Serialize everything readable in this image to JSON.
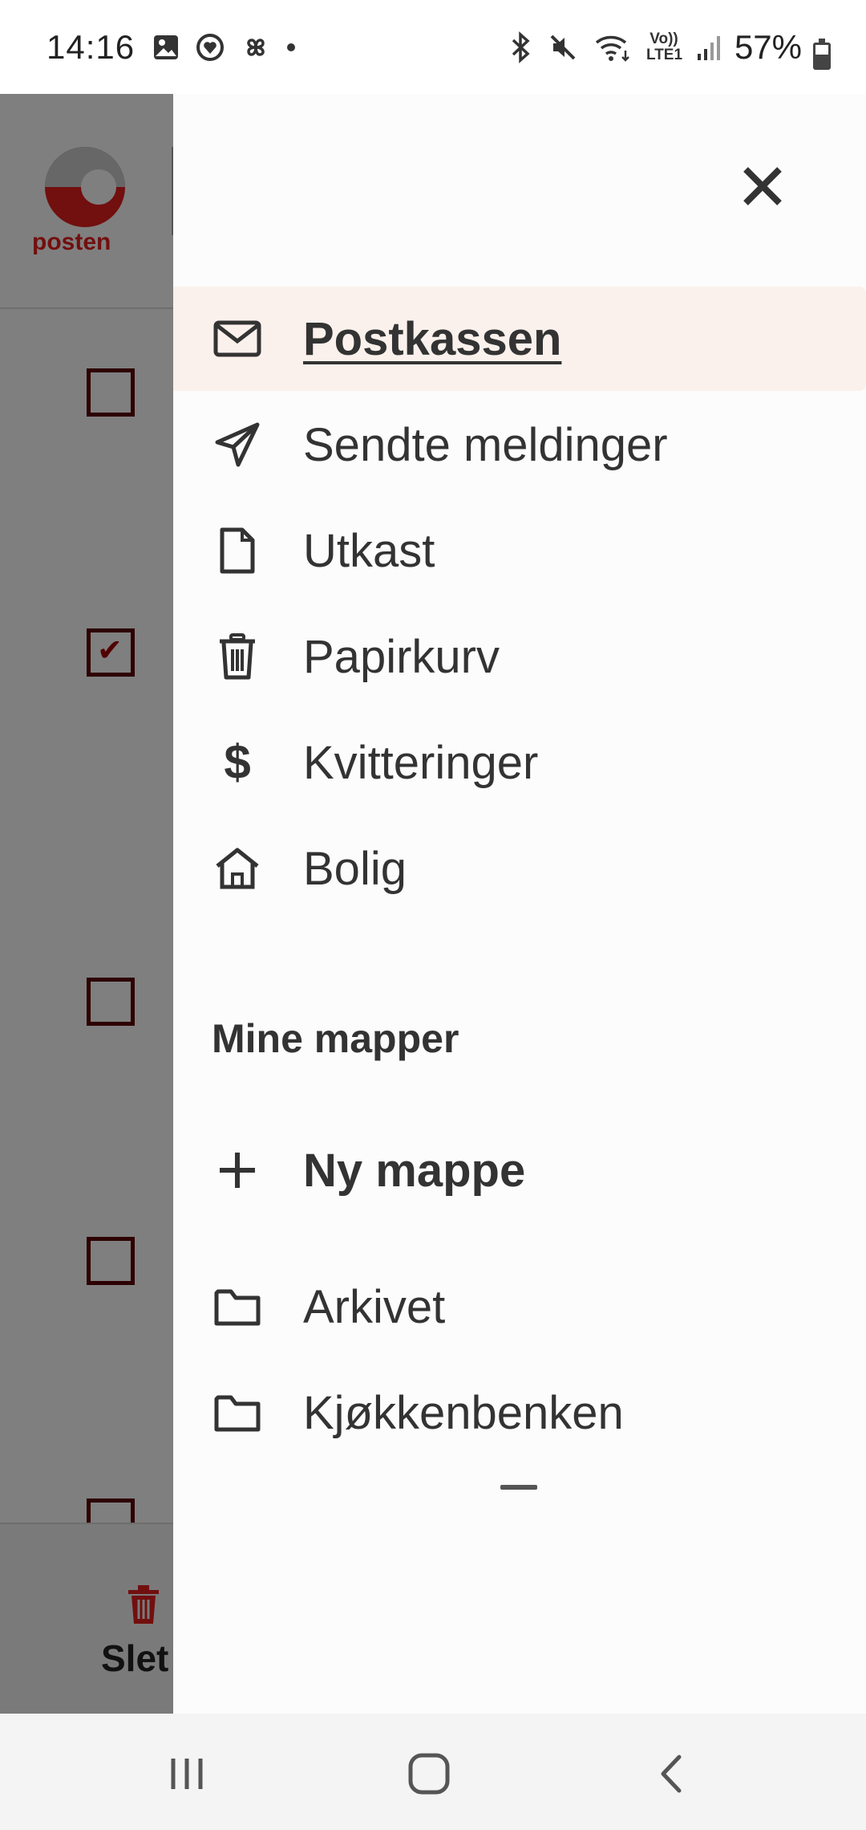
{
  "status_bar": {
    "time": "14:16",
    "battery_percent": "57%",
    "battery_level": 0.57,
    "left_icons": [
      "gallery-icon",
      "heart-circle-icon",
      "pinwheel-icon",
      "dot-icon"
    ],
    "right_icons": [
      "bluetooth-icon",
      "mute-icon",
      "wifi-icon",
      "volte-icon",
      "signal-icon",
      "battery-icon"
    ],
    "volte_label": "Vo)) LTE1"
  },
  "background_app": {
    "logo_text": "posten",
    "delete_label": "Slet",
    "checkboxes": [
      false,
      true,
      false,
      false,
      false
    ]
  },
  "drawer": {
    "nav_items": [
      {
        "label": "Postkassen",
        "icon": "mail-icon",
        "active": true
      },
      {
        "label": "Sendte meldinger",
        "icon": "send-icon",
        "active": false
      },
      {
        "label": "Utkast",
        "icon": "file-icon",
        "active": false
      },
      {
        "label": "Papirkurv",
        "icon": "trash-icon",
        "active": false
      },
      {
        "label": "Kvitteringer",
        "icon": "dollar-icon",
        "active": false
      },
      {
        "label": "Bolig",
        "icon": "home-icon",
        "active": false
      }
    ],
    "folders_heading": "Mine mapper",
    "new_folder_label": "Ny mappe",
    "folders": [
      {
        "label": "Arkivet",
        "icon": "folder-icon"
      },
      {
        "label": "Kjøkkenbenken",
        "icon": "folder-icon"
      }
    ],
    "accent_bg": "#fbf1ec"
  },
  "colors": {
    "brand_red": "#e41f1f",
    "text": "#333333",
    "drawer_bg": "#fcfcfc"
  }
}
